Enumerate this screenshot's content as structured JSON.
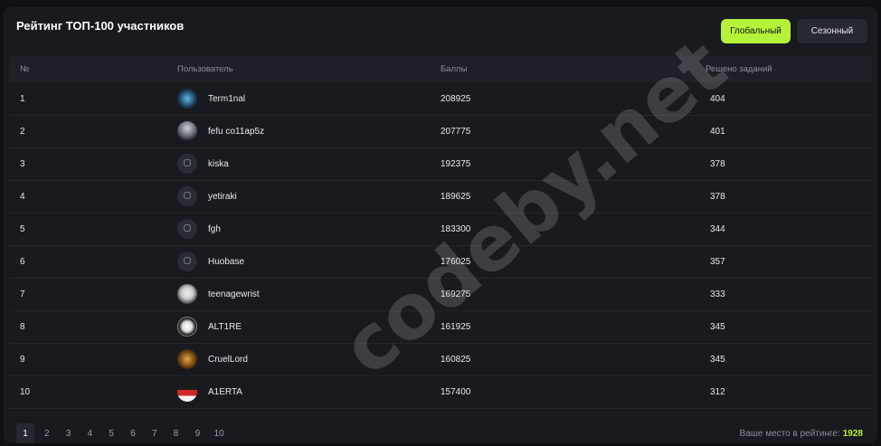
{
  "header": {
    "title": "Рейтинг ТОП-100 участников",
    "tab_global": "Глобальный",
    "tab_season": "Сезонный"
  },
  "columns": [
    "№",
    "Пользователь",
    "Баллы",
    "Решено заданий"
  ],
  "rows": [
    {
      "rank": "1",
      "user": "Term1nal",
      "score": "208925",
      "solved": "404",
      "avatar": "waveform-avatar"
    },
    {
      "rank": "2",
      "user": "fefu co11ap5z",
      "score": "207775",
      "solved": "401",
      "avatar": "photo-avatar"
    },
    {
      "rank": "3",
      "user": "kiska",
      "score": "192375",
      "solved": "378",
      "avatar": "default-avatar"
    },
    {
      "rank": "4",
      "user": "yetiraki",
      "score": "189625",
      "solved": "378",
      "avatar": "default-avatar"
    },
    {
      "rank": "5",
      "user": "fgh",
      "score": "183300",
      "solved": "344",
      "avatar": "default-avatar"
    },
    {
      "rank": "6",
      "user": "Huobase",
      "score": "176025",
      "solved": "357",
      "avatar": "default-avatar"
    },
    {
      "rank": "7",
      "user": "teenagewrist",
      "score": "169275",
      "solved": "333",
      "avatar": "cartoon-avatar"
    },
    {
      "rank": "8",
      "user": "ALT1RE",
      "score": "161925",
      "solved": "345",
      "avatar": "emblem-avatar"
    },
    {
      "rank": "9",
      "user": "CruelLord",
      "score": "160825",
      "solved": "345",
      "avatar": "wings-avatar"
    },
    {
      "rank": "10",
      "user": "A1ERTA",
      "score": "157400",
      "solved": "312",
      "avatar": "flag-avatar"
    }
  ],
  "pagination": [
    "1",
    "2",
    "3",
    "4",
    "5",
    "6",
    "7",
    "8",
    "9",
    "10"
  ],
  "active_page": "1",
  "my_place": {
    "label": "Ваше место в рейтинге:",
    "value": "1928"
  },
  "watermark": "codeby.net",
  "colors": {
    "accent": "#b5f23a",
    "panel": "#191a20",
    "background": "#0f1014"
  }
}
